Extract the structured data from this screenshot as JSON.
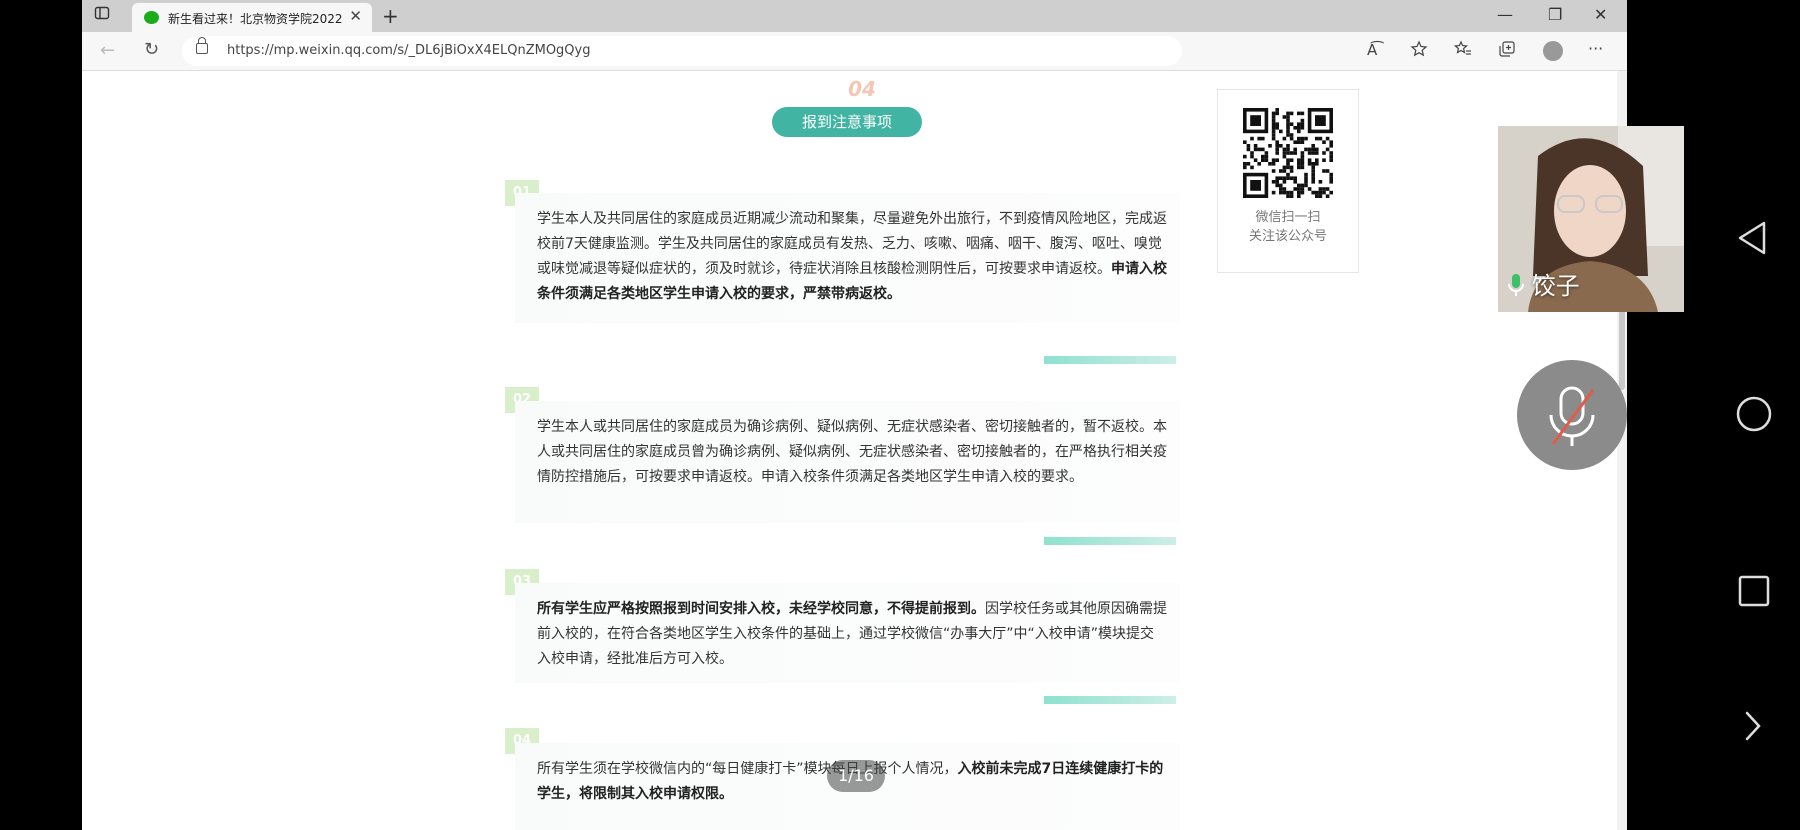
{
  "browser": {
    "tab_title": "新生看过来！北京物资学院2022",
    "tab_close": "✕",
    "new_tab": "+",
    "url": "https://mp.weixin.qq.com/s/_DL6jBiOxX4ELQnZMOgQyg",
    "window_min": "—",
    "window_restore": "❐",
    "window_close": "✕",
    "back": "←",
    "refresh": "↻",
    "read_aloud": "A͡",
    "more": "···"
  },
  "article": {
    "section_number": "04",
    "section_title": "报到注意事项",
    "items": [
      {
        "badge": "01",
        "text_normal": "学生本人及共同居住的家庭成员近期减少流动和聚集，尽量避免外出旅行，不到疫情风险地区，完成返校前7天健康监测。学生及共同居住的家庭成员有发热、乏力、咳嗽、咽痛、咽干、腹泻、呕吐、嗅觉或味觉减退等疑似症状的，须及时就诊，待症状消除且核酸检测阴性后，可按要求申请返校。",
        "text_bold": "申请入校条件须满足各类地区学生申请入校的要求，严禁带病返校。"
      },
      {
        "badge": "02",
        "text_normal": "学生本人或共同居住的家庭成员为确诊病例、疑似病例、无症状感染者、密切接触者的，暂不返校。本人或共同居住的家庭成员曾为确诊病例、疑似病例、无症状感染者、密切接触者的，在严格执行相关疫情防控措施后，可按要求申请返校。申请入校条件须满足各类地区学生申请入校的要求。"
      },
      {
        "badge": "03",
        "text_bold": "所有学生应严格按照报到时间安排入校，未经学校同意，不得提前报到。",
        "text_normal": "因学校任务或其他原因确需提前入校的，在符合各类地区学生入校条件的基础上，通过学校微信“办事大厅”中“入校申请”模块提交入校申请，经批准后方可入校。"
      },
      {
        "badge": "04",
        "text_normal": "所有学生须在学校微信内的“每日健康打卡”模块每日上报个人情况，",
        "text_bold": "入校前未完成7日连续健康打卡的学生，将限制其入校申请权限。"
      }
    ],
    "qr_caption_line1": "微信扫一扫",
    "qr_caption_line2": "关注该公众号",
    "page_counter": "1/16"
  },
  "video": {
    "speaker_name": "饺子"
  },
  "colors": {
    "accent": "#42b4a3",
    "badge": "#d9efcc",
    "bar": "#8fe1cf"
  },
  "icons": {
    "sidebar": "sidebar-icon",
    "wechat": "wechat-icon",
    "lock": "lock-icon",
    "mic_muted": "mic-muted-icon",
    "nav_back": "triangle-back-icon",
    "nav_home": "circle-home-icon",
    "nav_recents": "square-recents-icon",
    "nav_next": "chevron-right-icon"
  }
}
